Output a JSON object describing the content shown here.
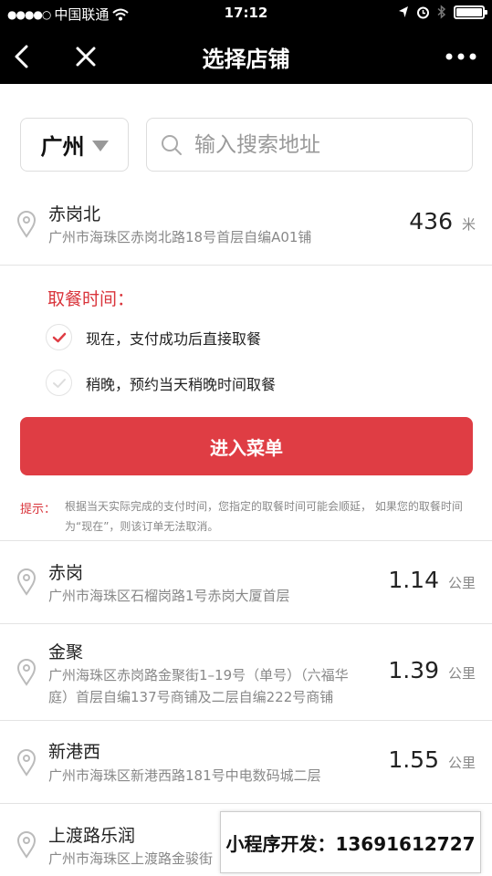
{
  "status_bar": {
    "carrier": "中国联通",
    "time": "17:12"
  },
  "nav": {
    "title": "选择店铺",
    "more_label": "•••"
  },
  "city_select": {
    "value": "广州"
  },
  "search": {
    "placeholder": "输入搜索地址"
  },
  "selected_store": {
    "name": "赤岗北",
    "address": "广州市海珠区赤岗北路18号首层自编A01铺",
    "distance": "436",
    "unit": "米"
  },
  "pickup": {
    "title": "取餐时间：",
    "options": [
      {
        "label": "现在，支付成功后直接取餐",
        "selected": true
      },
      {
        "label": "稍晚，预约当天稍晚时间取餐",
        "selected": false
      }
    ]
  },
  "menu_button": {
    "label": "进入菜单"
  },
  "tip": {
    "label": "提示：",
    "text": "根据当天实际完成的支付时间，您指定的取餐时间可能会顺延， 如果您的取餐时间为“现在”，则该订单无法取消。"
  },
  "stores": [
    {
      "name": "赤岗",
      "address": "广州市海珠区石榴岗路1号赤岗大厦首层",
      "distance": "1.14",
      "unit": "公里"
    },
    {
      "name": "金聚",
      "address": "广州海珠区赤岗路金聚街1–19号（单号）（六福华庭）首层自编137号商铺及二层自编222号商铺",
      "distance": "1.39",
      "unit": "公里"
    },
    {
      "name": "新港西",
      "address": "广州市海珠区新港西路181号中电数码城二层",
      "distance": "1.55",
      "unit": "公里"
    },
    {
      "name": "上渡路乐润",
      "address": "广州市海珠区上渡路金骏街"
    }
  ],
  "contact_overlay": {
    "text": "小程序开发：13691612727"
  },
  "colors": {
    "accent": "#df3d44",
    "nav_bg": "#000000"
  }
}
